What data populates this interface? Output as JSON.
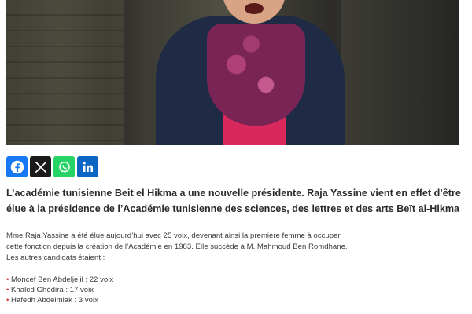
{
  "share": {
    "buttons": [
      {
        "icon": "facebook-icon",
        "color": "#1877f2"
      },
      {
        "icon": "x-icon",
        "color": "#1a1a1a"
      },
      {
        "icon": "whatsapp-icon",
        "color": "#25d366"
      },
      {
        "icon": "linkedin-icon",
        "color": "#0a66c2"
      }
    ]
  },
  "article": {
    "lead": "L’académie tunisienne Beit el Hikma a une nouvelle présidente. Raja Yassine vient en effet d’être élue à la présidence de l’Académie tunisienne des sciences, des lettres et des arts Beït al-Hikma",
    "body": "Mme Raja Yassine a été élue aujourd’hui avec 25 voix, devenant ainsi la première femme à occuper cette fonction depuis la création de l’Académie en 1983. Elle succède à M. Mahmoud Ben Romdhane. Les autres candidats étaient :",
    "candidates": [
      "Moncef Ben Abdeljelil : 22 voix",
      "Khaled Ghédira : 17 voix",
      "Hafedh Abdelmlak : 3 voix"
    ],
    "bullet": "•"
  }
}
